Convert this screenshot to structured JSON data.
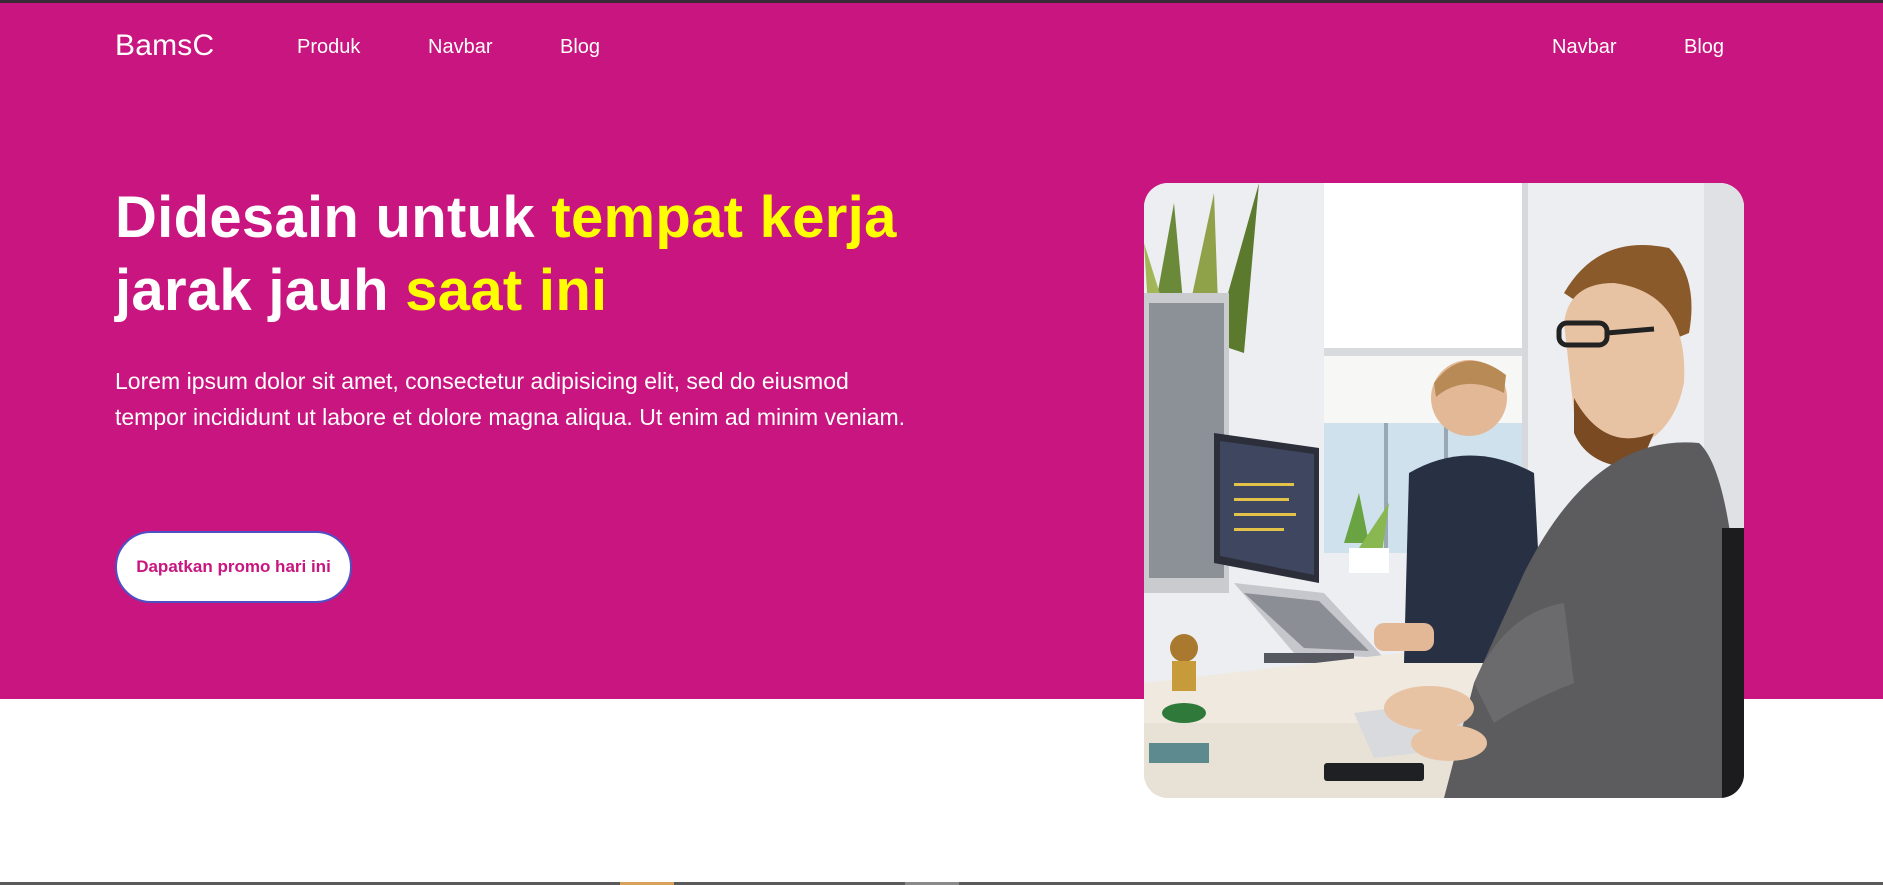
{
  "nav": {
    "brand": "BamsC",
    "left_links": [
      "Produk",
      "Navbar",
      "Blog"
    ],
    "right_links": [
      "Navbar",
      "Blog"
    ]
  },
  "hero": {
    "headline_line1_white": "Didesain untuk ",
    "headline_line1_yellow": "tempat kerja",
    "headline_line2_white": "jarak jauh ",
    "headline_line2_yellow": "saat ini",
    "lead": "Lorem ipsum dolor sit amet, consectetur adipisicing elit, sed do eiusmod tempor incididunt ut labore et dolore magna aliqua. Ut enim ad minim veniam.",
    "cta_label": "Dapatkan promo hari ini",
    "image_description": "office-workers-photo"
  },
  "colors": {
    "hero_background": "#c8157f",
    "highlight": "#ffff00",
    "text_light": "#ffffff",
    "cta_border": "#4f4fc6"
  }
}
